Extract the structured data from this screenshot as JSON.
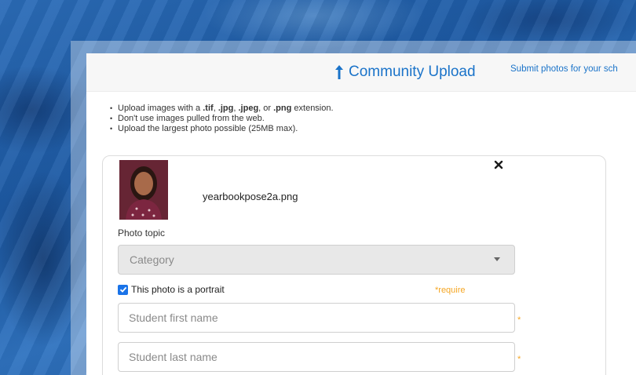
{
  "header": {
    "title": "Community Upload",
    "subtitle": "Submit photos for your sch"
  },
  "rules": {
    "rule1_a": "Upload images with a ",
    "rule1_tif": ".tif",
    "rule1_sep1": ", ",
    "rule1_jpg": ".jpg",
    "rule1_sep2": ", ",
    "rule1_jpeg": ".jpeg",
    "rule1_sep3": ", or ",
    "rule1_png": ".png",
    "rule1_b": " extension.",
    "rule2": "Don't use images pulled from the web.",
    "rule3": "Upload the largest photo possible (25MB max)."
  },
  "upload_item": {
    "filename": "yearbookpose2a.png",
    "photo_topic_label": "Photo topic",
    "category_select": {
      "selected": "Category"
    },
    "portrait_checkbox": {
      "label": "This photo is a portrait",
      "checked": true
    },
    "require_note": "*require",
    "first_name_input": {
      "placeholder": "Student first name",
      "value": ""
    },
    "last_name_input": {
      "placeholder": "Student last name",
      "value": ""
    },
    "required_marker": "*",
    "close_icon": "close-icon"
  },
  "colors": {
    "accent": "#1a73c9",
    "require": "#f5a623",
    "checkbox": "#1a73e8"
  }
}
